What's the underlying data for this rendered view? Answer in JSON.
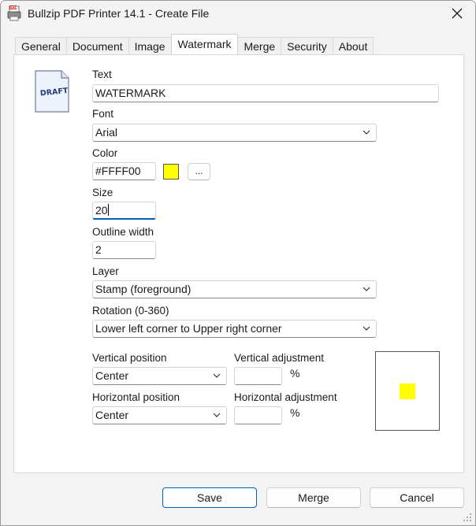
{
  "window": {
    "title": "Bullzip PDF Printer 14.1 - Create File",
    "app_icon": "pdf-printer-icon",
    "close_icon": "close-icon"
  },
  "tabs": [
    {
      "label": "General",
      "active": false
    },
    {
      "label": "Document",
      "active": false
    },
    {
      "label": "Image",
      "active": false
    },
    {
      "label": "Watermark",
      "active": true
    },
    {
      "label": "Merge",
      "active": false
    },
    {
      "label": "Security",
      "active": false
    },
    {
      "label": "About",
      "active": false
    }
  ],
  "watermark": {
    "icon_label": "DRAFT",
    "text": {
      "label": "Text",
      "value": "WATERMARK"
    },
    "font": {
      "label": "Font",
      "value": "Arial"
    },
    "color": {
      "label": "Color",
      "value": "#FFFF00",
      "display_value": "#FFFF00",
      "picker_label": "..."
    },
    "size": {
      "label": "Size",
      "value": "20"
    },
    "outline_width": {
      "label": "Outline width",
      "value": "2"
    },
    "layer": {
      "label": "Layer",
      "value": "Stamp (foreground)"
    },
    "rotation": {
      "label": "Rotation (0-360)",
      "value": "Lower left corner to Upper right corner"
    },
    "vertical_position": {
      "label": "Vertical position",
      "value": "Center"
    },
    "vertical_adjustment": {
      "label": "Vertical adjustment",
      "value": "",
      "unit": "%"
    },
    "horizontal_position": {
      "label": "Horizontal position",
      "value": "Center"
    },
    "horizontal_adjustment": {
      "label": "Horizontal adjustment",
      "value": "",
      "unit": "%"
    }
  },
  "buttons": {
    "save": "Save",
    "merge": "Merge",
    "cancel": "Cancel"
  },
  "colors": {
    "accent": "#005fb8",
    "watermark_color": "#FFFF00"
  }
}
